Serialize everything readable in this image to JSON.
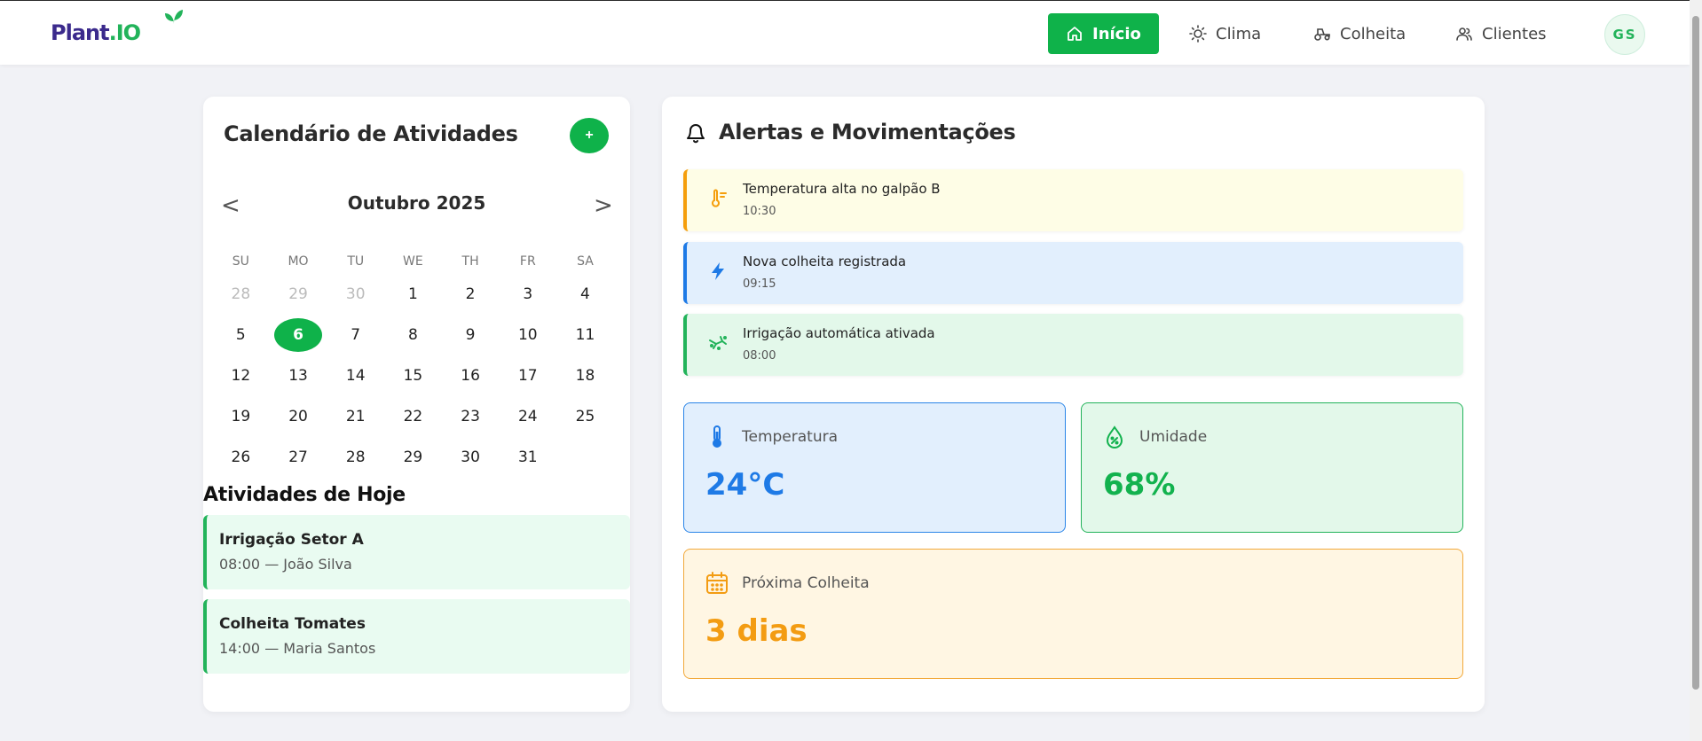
{
  "brand": {
    "name_part1": "Plant",
    "name_dot": ".",
    "name_part2": "IO"
  },
  "nav": {
    "items": [
      {
        "label": "Início",
        "icon": "home-icon",
        "active": true
      },
      {
        "label": "Clima",
        "icon": "sun-icon"
      },
      {
        "label": "Colheita",
        "icon": "tractor-icon"
      },
      {
        "label": "Clientes",
        "icon": "users-icon"
      }
    ],
    "avatar_initials": "GS"
  },
  "calendar": {
    "title": "Calendário de Atividades",
    "add_label": "+",
    "month_label": "Outubro 2025",
    "prev_label": "<",
    "next_label": ">",
    "weekdays": [
      "SU",
      "MO",
      "TU",
      "WE",
      "TH",
      "FR",
      "SA"
    ],
    "weeks": [
      [
        {
          "d": "28",
          "muted": true
        },
        {
          "d": "29",
          "muted": true
        },
        {
          "d": "30",
          "muted": true
        },
        {
          "d": "1"
        },
        {
          "d": "2"
        },
        {
          "d": "3"
        },
        {
          "d": "4"
        }
      ],
      [
        {
          "d": "5"
        },
        {
          "d": "6",
          "today": true
        },
        {
          "d": "7"
        },
        {
          "d": "8"
        },
        {
          "d": "9"
        },
        {
          "d": "10"
        },
        {
          "d": "11"
        }
      ],
      [
        {
          "d": "12"
        },
        {
          "d": "13"
        },
        {
          "d": "14"
        },
        {
          "d": "15"
        },
        {
          "d": "16"
        },
        {
          "d": "17"
        },
        {
          "d": "18"
        }
      ],
      [
        {
          "d": "19"
        },
        {
          "d": "20"
        },
        {
          "d": "21"
        },
        {
          "d": "22"
        },
        {
          "d": "23"
        },
        {
          "d": "24"
        },
        {
          "d": "25"
        }
      ],
      [
        {
          "d": "26"
        },
        {
          "d": "27"
        },
        {
          "d": "28"
        },
        {
          "d": "29"
        },
        {
          "d": "30"
        },
        {
          "d": "31"
        },
        {
          "d": ""
        }
      ]
    ]
  },
  "today": {
    "title": "Atividades de Hoje",
    "activities": [
      {
        "title": "Irrigação Setor A",
        "subtitle": "08:00 — João Silva"
      },
      {
        "title": "Colheita Tomates",
        "subtitle": "14:00 — Maria Santos"
      }
    ]
  },
  "alerts": {
    "title": "Alertas e Movimentações",
    "items": [
      {
        "title": "Temperatura alta no galpão B",
        "time": "10:30",
        "icon": "thermometer-icon",
        "color": "#f59e0b"
      },
      {
        "title": "Nova colheita registrada",
        "time": "09:15",
        "icon": "bolt-icon",
        "color": "#1e7ae6"
      },
      {
        "title": "Irrigação automática ativada",
        "time": "08:00",
        "icon": "sprinkler-icon",
        "color": "#22b35a"
      }
    ]
  },
  "stats": {
    "temperature": {
      "label": "Temperatura",
      "value": "24°C",
      "icon": "thermometer-icon",
      "color": "#1e7ae6"
    },
    "humidity": {
      "label": "Umidade",
      "value": "68%",
      "icon": "droplet-percent-icon",
      "color": "#12b24e"
    },
    "next_harvest": {
      "label": "Próxima Colheita",
      "value": "3 dias",
      "icon": "calendar-icon",
      "color": "#f39c12"
    }
  }
}
